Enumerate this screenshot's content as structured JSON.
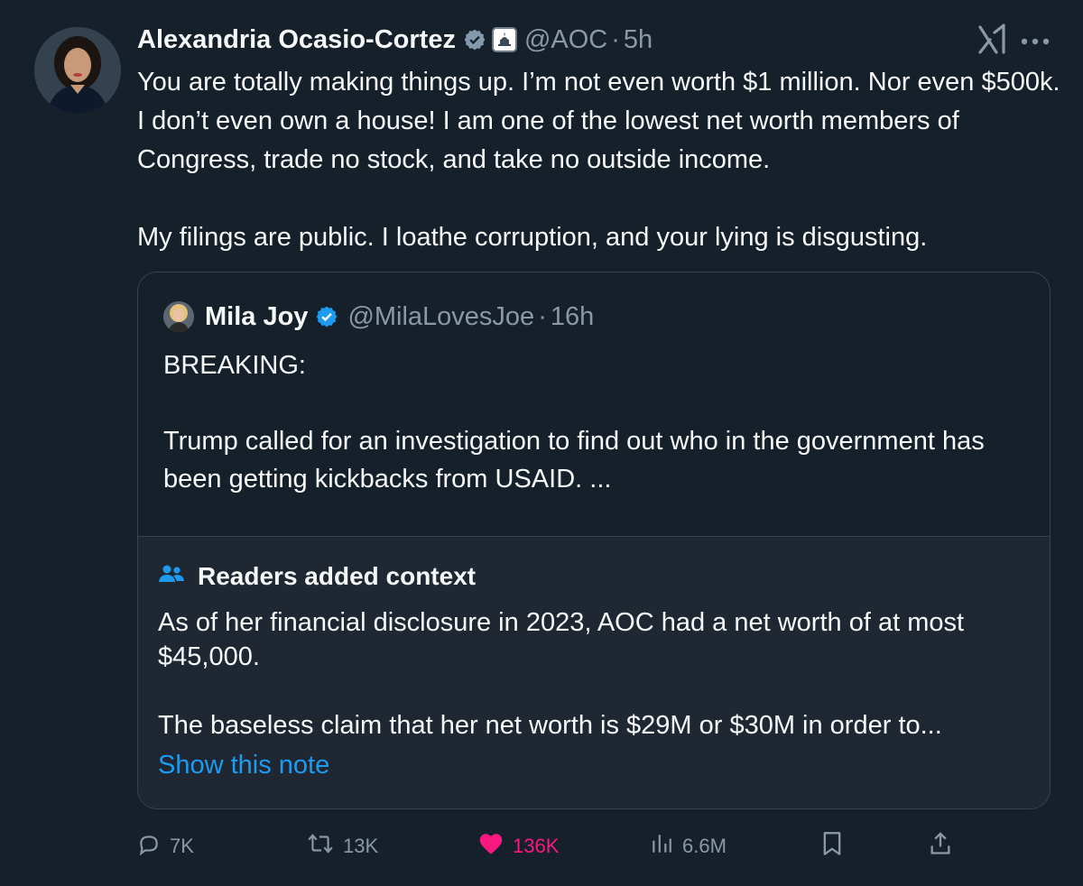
{
  "tweet": {
    "author_name": "Alexandria Ocasio-Cortez",
    "handle": "@AOC",
    "separator": "·",
    "time": "5h",
    "text_p1": "You are totally making things up. I’m not even worth $1 million. Nor even $500k. I don’t even own a house! I am one of the lowest net worth members of Congress, trade no stock, and take no outside income.",
    "text_p2": "My filings are public. I loathe corruption, and your lying is disgusting."
  },
  "quoted": {
    "author_name": "Mila Joy",
    "handle": "@MilaLovesJoe",
    "separator": "·",
    "time": "16h",
    "text_p1": "BREAKING:",
    "text_p2": "Trump called for an investigation to find out who in the government has been getting kickbacks from USAID. ..."
  },
  "community_note": {
    "title": "Readers added context",
    "text_p1": "As of her financial disclosure in 2023, AOC had a net worth of at most $45,000.",
    "text_p2": "The baseless claim that her net worth is $29M or $30M in order to...",
    "link": "Show this note"
  },
  "actions": {
    "replies": "7K",
    "reposts": "13K",
    "likes": "136K",
    "views": "6.6M"
  },
  "colors": {
    "background": "#15202b",
    "verified": "#1d9bf0",
    "like": "#f91880",
    "muted": "#8b98a5",
    "link": "#1d9bf0"
  }
}
